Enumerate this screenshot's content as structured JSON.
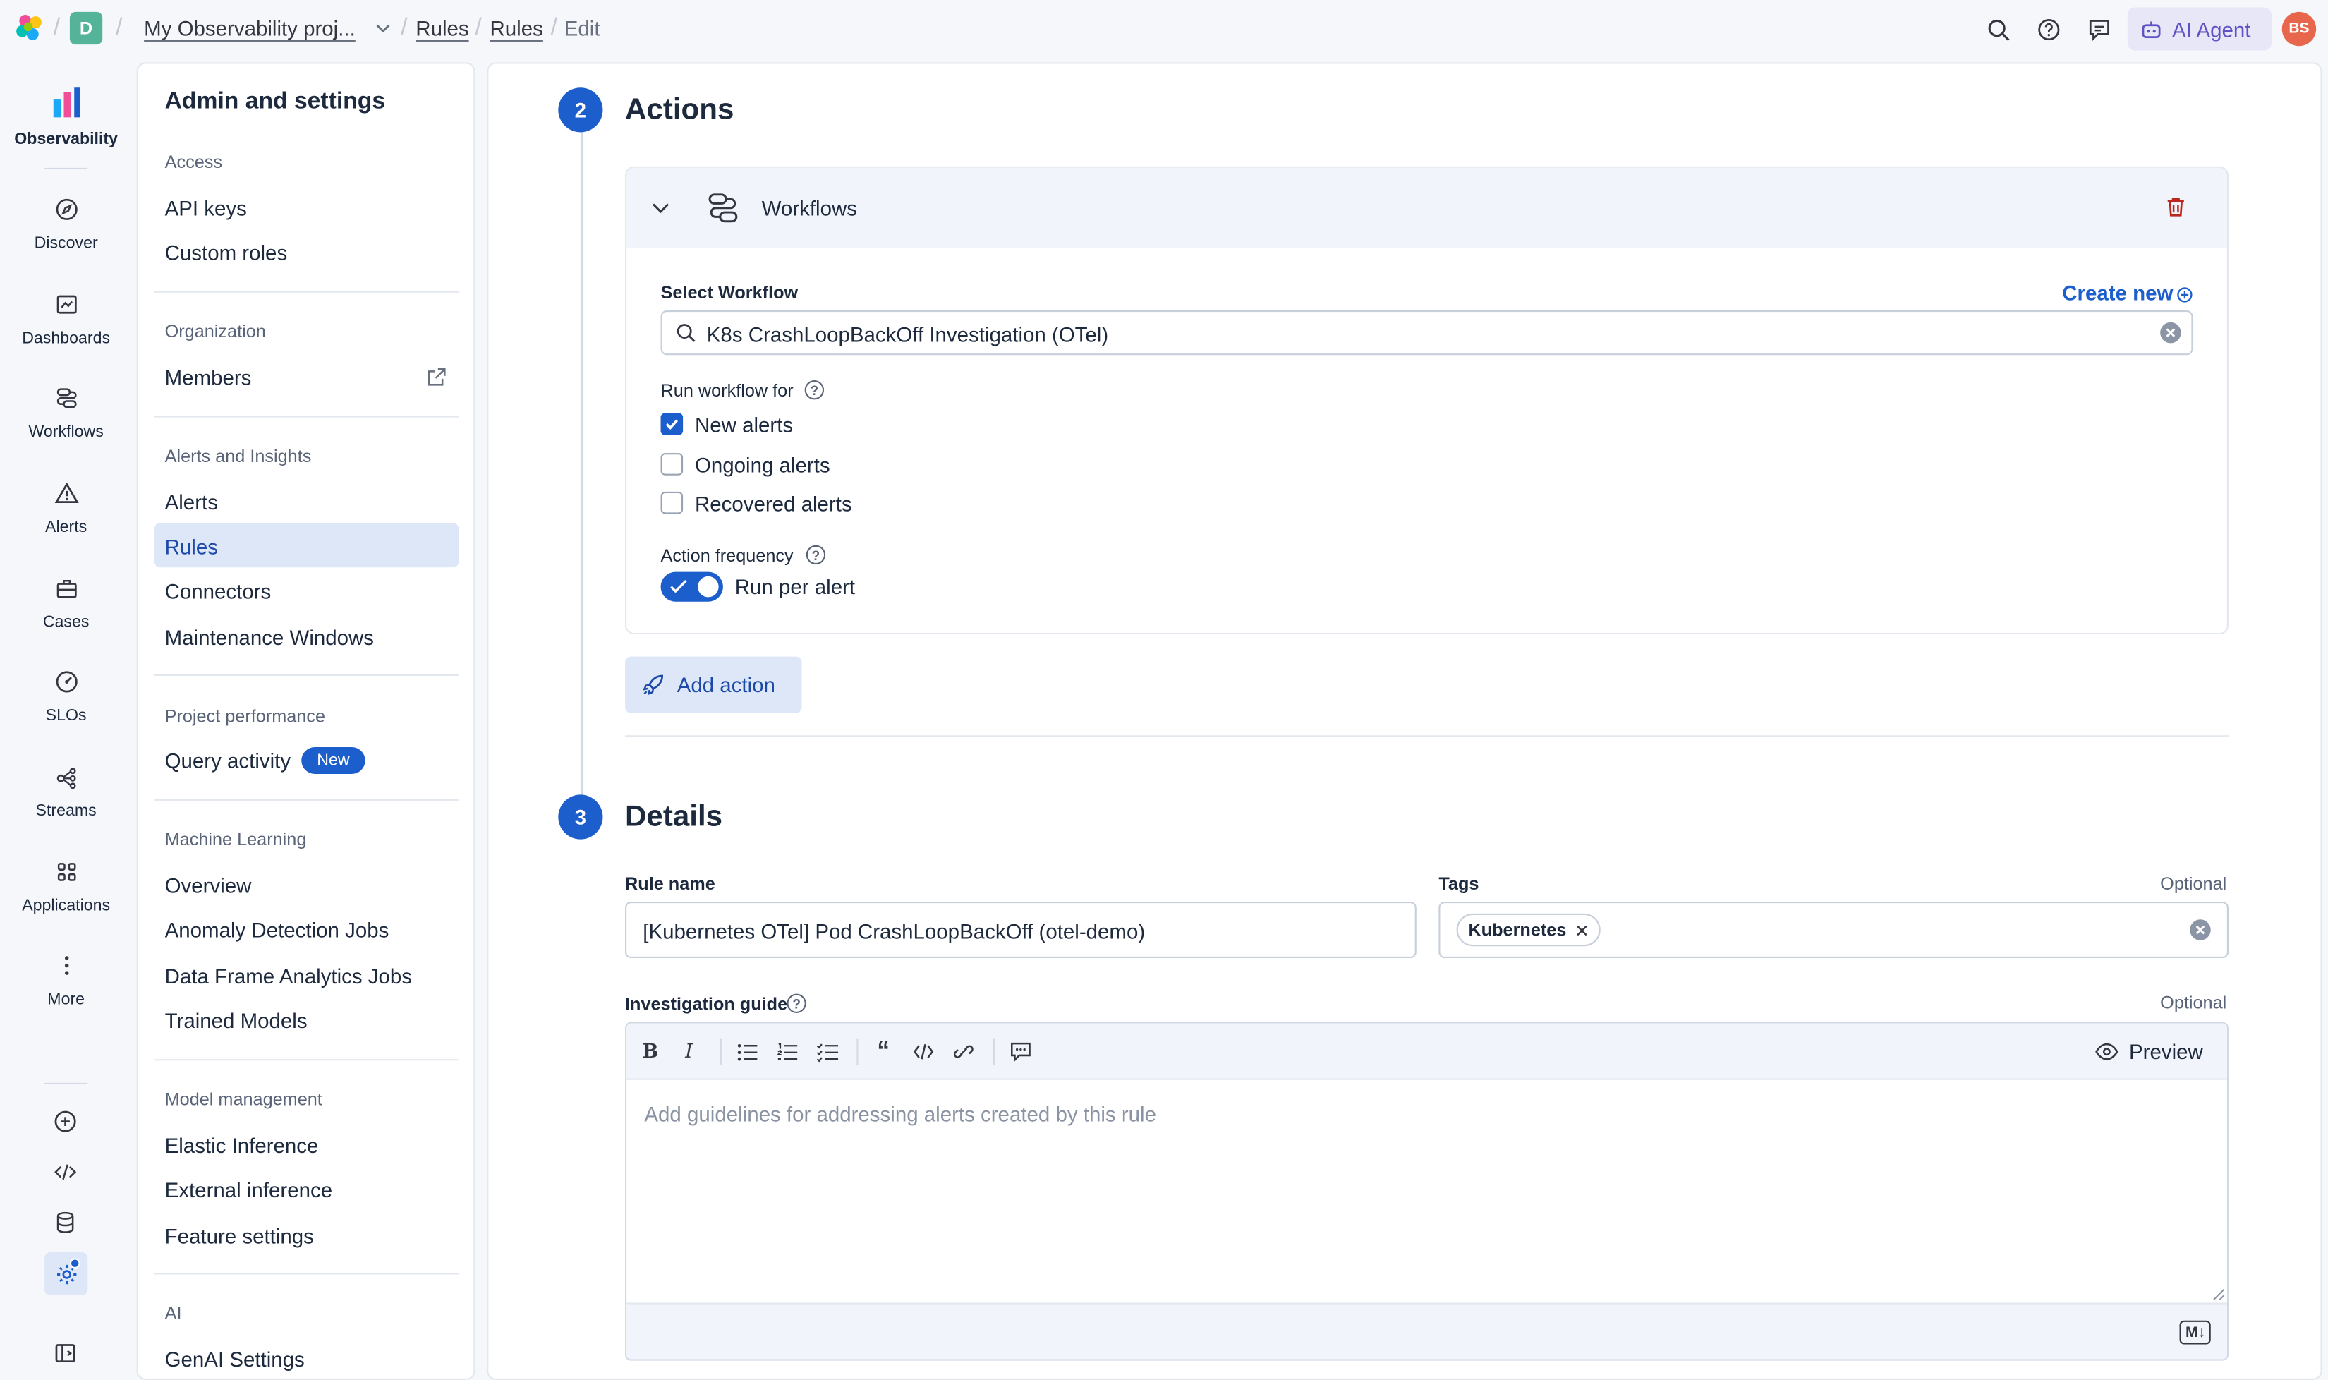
{
  "topbar": {
    "space_initial": "D",
    "project": "My Observability proj...",
    "breadcrumbs": [
      "Rules",
      "Rules",
      "Edit"
    ],
    "ai_agent_label": "AI Agent",
    "user_initials": "BS",
    "icons": [
      "search-icon",
      "help-icon",
      "feedback-icon",
      "ai-agent-icon"
    ]
  },
  "nav": {
    "items": [
      {
        "label": "Observability",
        "icon": "observability-logo-icon"
      },
      {
        "label": "Discover",
        "icon": "compass-icon"
      },
      {
        "label": "Dashboards",
        "icon": "dashboard-icon"
      },
      {
        "label": "Workflows",
        "icon": "workflows-icon"
      },
      {
        "label": "Alerts",
        "icon": "warning-icon"
      },
      {
        "label": "Cases",
        "icon": "briefcase-icon"
      },
      {
        "label": "SLOs",
        "icon": "gauge-icon"
      },
      {
        "label": "Streams",
        "icon": "streams-icon"
      },
      {
        "label": "Applications",
        "icon": "grid-icon"
      },
      {
        "label": "More",
        "icon": "dots-vertical-icon"
      }
    ]
  },
  "sidepanel": {
    "title": "Admin and settings",
    "sections": [
      {
        "label": "Access",
        "links": [
          "API keys",
          "Custom roles"
        ]
      },
      {
        "label": "Organization",
        "links": [
          "Members"
        ]
      },
      {
        "label": "Alerts and Insights",
        "links": [
          "Alerts",
          "Rules",
          "Connectors",
          "Maintenance Windows"
        ]
      },
      {
        "label": "Project performance",
        "links": [
          "Query activity"
        ],
        "badge": "New"
      },
      {
        "label": "Machine Learning",
        "links": [
          "Overview",
          "Anomaly Detection Jobs",
          "Data Frame Analytics Jobs",
          "Trained Models"
        ]
      },
      {
        "label": "Model management",
        "links": [
          "Elastic Inference",
          "External inference",
          "Feature settings"
        ]
      },
      {
        "label": "AI",
        "links": [
          "GenAI Settings"
        ]
      }
    ],
    "active": "Rules"
  },
  "actions": {
    "step": "2",
    "title": "Actions",
    "connector": "Workflows",
    "select_label": "Select Workflow",
    "create_new": "Create new",
    "selected_workflow": "K8s CrashLoopBackOff Investigation (OTel)",
    "run_for_label": "Run workflow for",
    "checkboxes": [
      {
        "label": "New alerts",
        "checked": true
      },
      {
        "label": "Ongoing alerts",
        "checked": false
      },
      {
        "label": "Recovered alerts",
        "checked": false
      }
    ],
    "frequency_label": "Action frequency",
    "frequency_toggle": "Run per alert",
    "toggle_on": true,
    "add_action": "Add action"
  },
  "details": {
    "step": "3",
    "title": "Details",
    "rule_name_label": "Rule name",
    "rule_name": "[Kubernetes OTel] Pod CrashLoopBackOff (otel-demo)",
    "tags_label": "Tags",
    "tags_optional": "Optional",
    "tags": [
      "Kubernetes"
    ],
    "guide_label": "Investigation guide",
    "guide_optional": "Optional",
    "guide_placeholder": "Add guidelines for addressing alerts created by this rule",
    "preview": "Preview",
    "markdown_badge": "M↓"
  },
  "colors": {
    "primary": "#1c5ecc",
    "accent_ai": "#5f53c4",
    "danger": "#bd271e",
    "active_bg": "#dde7f7"
  }
}
